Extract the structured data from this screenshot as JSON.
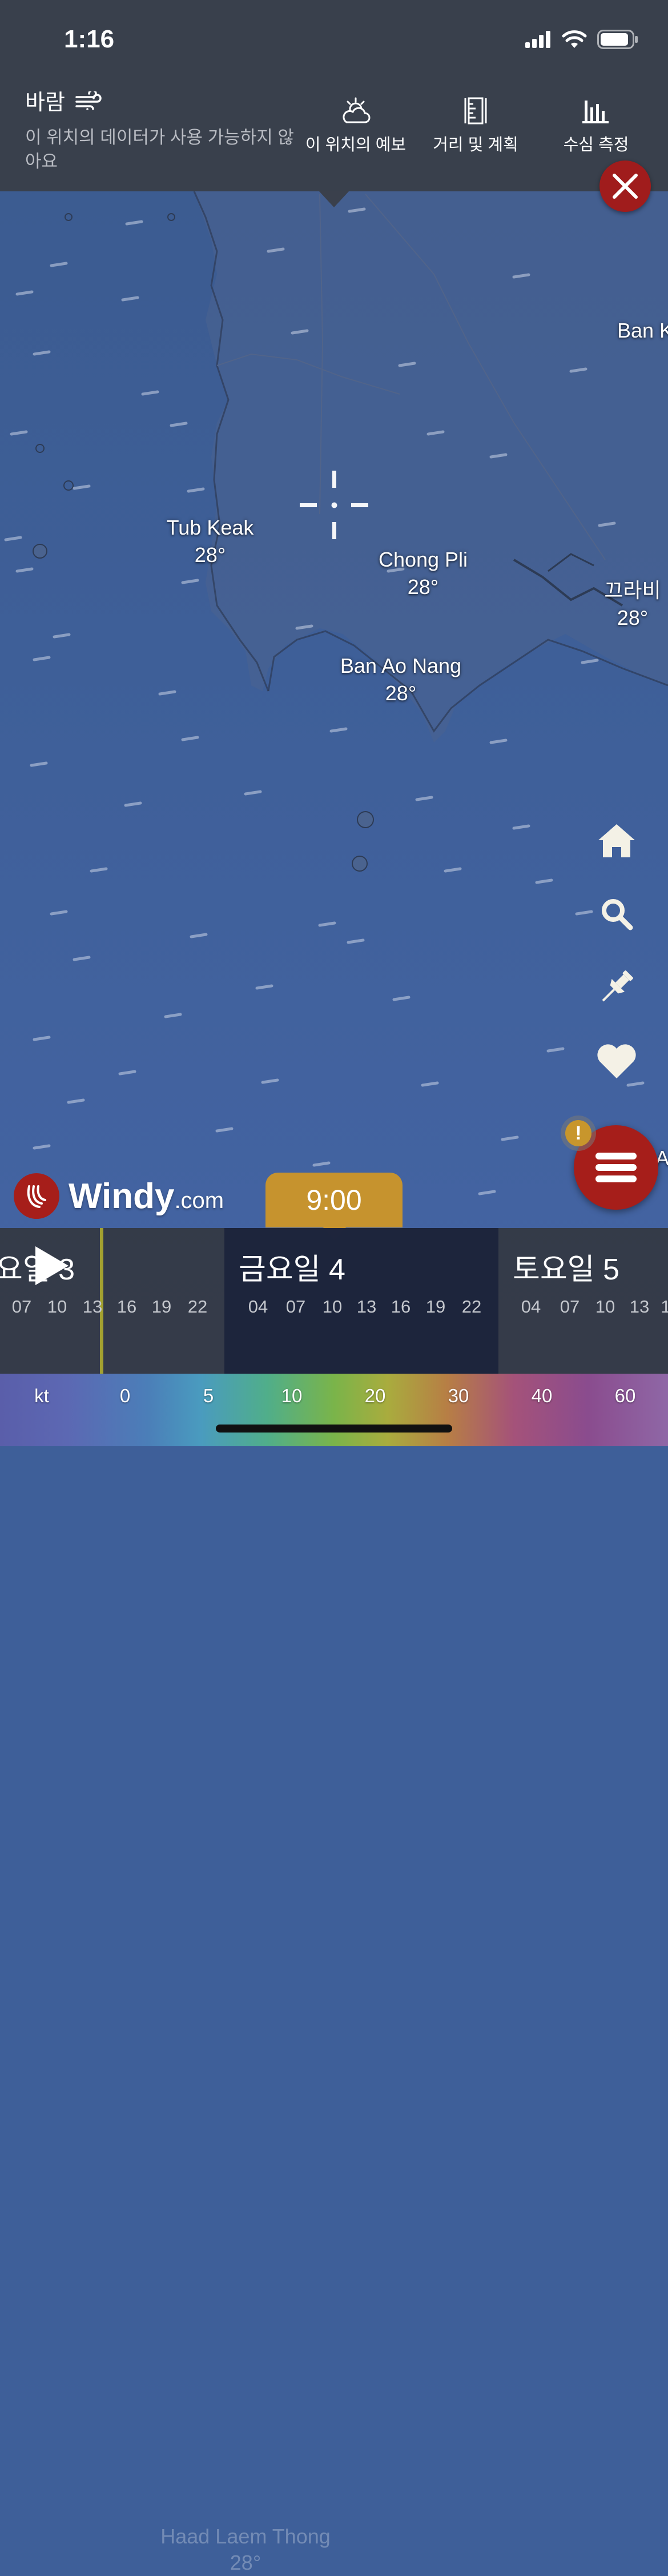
{
  "status_bar": {
    "time": "1:16"
  },
  "layer": {
    "title": "바람",
    "icon": "wind-icon",
    "message": "이 위치의 데이터가 사용 가능하지 않아요"
  },
  "tools": [
    {
      "label": "이 위치의 예보",
      "icon": "forecast-cloud-sun-icon"
    },
    {
      "label": "거리 및 계획",
      "icon": "ruler-icon"
    },
    {
      "label": "수심 측정",
      "icon": "bar-chart-icon"
    }
  ],
  "map_places": [
    {
      "name": "Ban K",
      "temp": ""
    },
    {
      "name": "Tub Keak",
      "temp": "28°"
    },
    {
      "name": "Chong Pli",
      "temp": "28°"
    },
    {
      "name": "끄라비",
      "temp": "28°"
    },
    {
      "name": "Ban Ao Nang",
      "temp": "28°"
    },
    {
      "name": "A",
      "temp": ""
    }
  ],
  "logo": {
    "name": "Windy",
    "domain": ".com"
  },
  "timeline": {
    "selected_time": "9:00",
    "days": [
      {
        "label": "요일 3",
        "hours": [
          "07",
          "10",
          "13",
          "16",
          "19",
          "22"
        ]
      },
      {
        "label": "금요일 4",
        "hours": [
          "04",
          "07",
          "10",
          "13",
          "16",
          "19",
          "22"
        ]
      },
      {
        "label": "토요일 5",
        "hours": [
          "04",
          "07",
          "10",
          "13",
          "1"
        ]
      }
    ],
    "ghost_place": {
      "name": "Haad Laem Thong",
      "temp": "28°"
    }
  },
  "legend": {
    "unit": "kt",
    "values": [
      "0",
      "5",
      "10",
      "20",
      "30",
      "40",
      "60"
    ]
  },
  "colors": {
    "accent_red": "#a61e1a",
    "time_bubble": "#c6932e",
    "now_line": "#a3a130"
  }
}
